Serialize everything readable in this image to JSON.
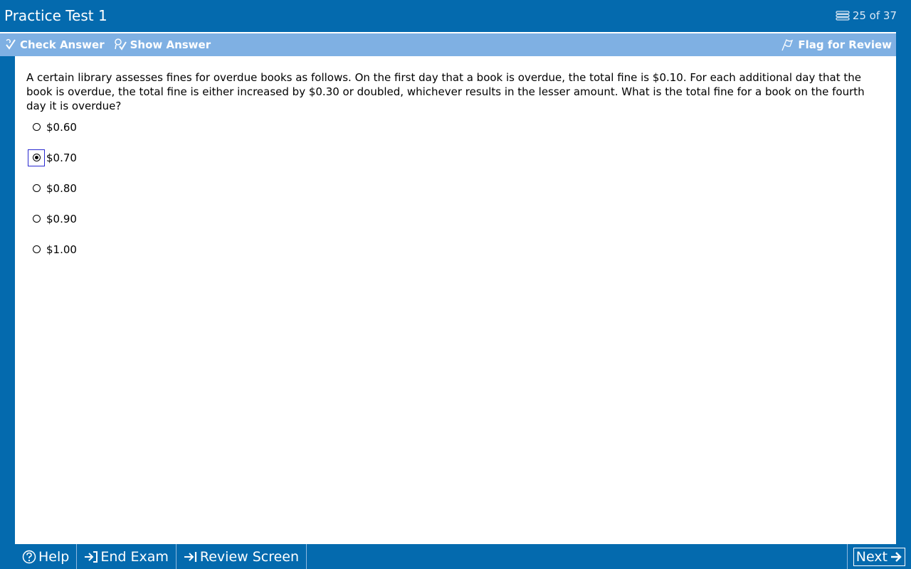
{
  "header": {
    "title": "Practice Test 1",
    "progress": "25 of 37",
    "progress_icon": "stack-icon"
  },
  "toolbar": {
    "check_answer": "Check Answer",
    "show_answer": "Show Answer",
    "flag_review": "Flag for Review"
  },
  "question": {
    "text": "A certain library assesses fines for overdue books as follows.  On the first day that a book is overdue, the total fine is $0.10.  For each additional day that the book is overdue, the total fine is either increased by $0.30 or doubled, whichever results in the lesser amount.  What is the total fine for a book on the fourth day it is overdue?",
    "choices": [
      {
        "label": "$0.60",
        "selected": false
      },
      {
        "label": "$0.70",
        "selected": true
      },
      {
        "label": "$0.80",
        "selected": false
      },
      {
        "label": "$0.90",
        "selected": false
      },
      {
        "label": "$1.00",
        "selected": false
      }
    ]
  },
  "footer": {
    "help": "Help",
    "end_exam": "End Exam",
    "review_screen": "Review Screen",
    "next": "Next"
  },
  "colors": {
    "frame": "#046aae",
    "toolbar": "#7fb0e3",
    "content": "#ffffff",
    "selection_border": "#2a2ad0"
  }
}
